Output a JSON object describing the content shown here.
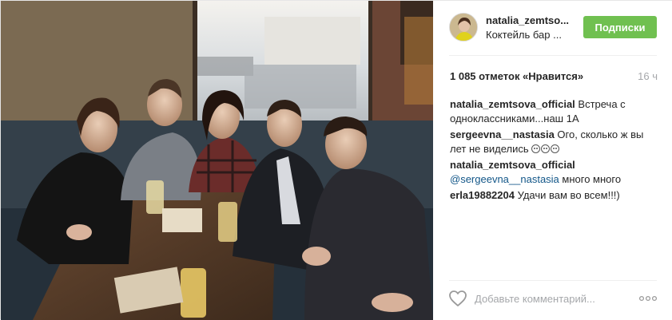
{
  "post": {
    "username": "natalia_zemtso...",
    "location": "Коктейль бар ...",
    "follow_label": "Подписки",
    "likes": "1 085 отметок «Нравится»",
    "time": "16 ч",
    "comments": [
      {
        "author": "natalia_zemtsova_official",
        "text": " Встреча с одноклассниками...наш 1А"
      },
      {
        "author": "sergeevna__nastasia",
        "text": " Ого, сколько ж вы лет не виделись "
      },
      {
        "author": "natalia_zemtsova_official",
        "mention": "@sergeevna__nastasia",
        "text": " много много"
      },
      {
        "author": "erla19882204",
        "text": " Удачи вам во всем!!!)"
      }
    ],
    "emoji_count": 3,
    "comment_placeholder": "Добавьте комментарий...",
    "more_label": "ooo"
  },
  "colors": {
    "follow_button": "#70c050",
    "mention": "#125688",
    "muted_text": "#a5a7aa",
    "divider": "#efefef"
  },
  "icons": {
    "like": "heart-outline-icon",
    "more": "more-options-icon"
  }
}
